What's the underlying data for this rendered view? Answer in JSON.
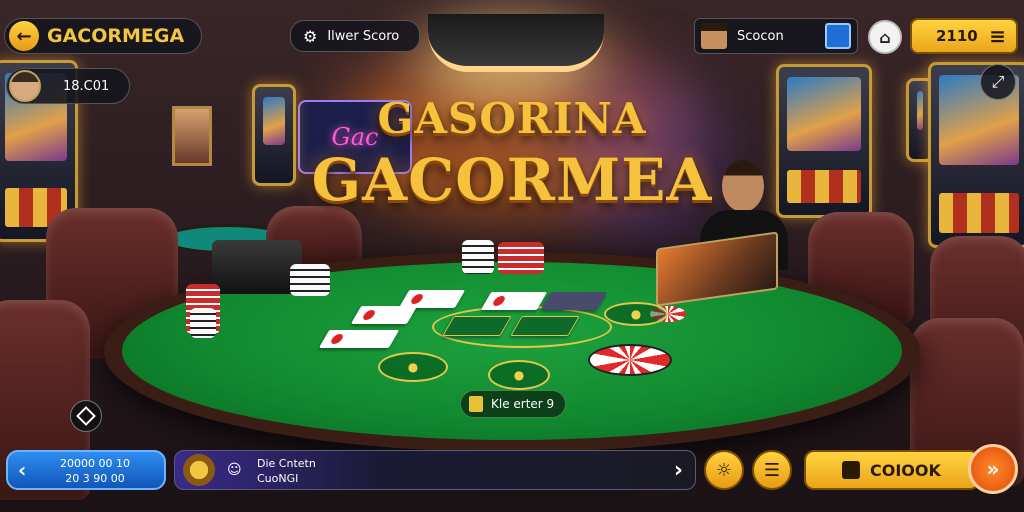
{
  "header": {
    "back_icon": "arrow-left-icon",
    "app_title": "GACORMEGA",
    "settings_icon": "gear-icon",
    "room_label": "Ilwer Scoro",
    "profile_name": "Scocon",
    "profile_badge_icon": "chip-icon",
    "shop_icon": "store-icon",
    "coins_value": "2110",
    "menu_icon": "hamburger-icon",
    "balance_value": "18.C01",
    "fullscreen_icon": "expand-icon"
  },
  "scene": {
    "title_line1": "GASORINA",
    "title_line2": "GACORMEA",
    "neon_sign": "Gac"
  },
  "table": {
    "hint_label": "Kle erter 9"
  },
  "footer": {
    "bet_line1": "20000 00 10",
    "bet_line2": "20 3 90 00",
    "chat_line1": "Die Cntetn",
    "chat_line2": "CuoNGI",
    "check_label": "COIOOK"
  },
  "colors": {
    "accent_gold": "#f6c23c",
    "felt_green": "#118a30",
    "button_blue": "#1f6fd8",
    "button_orange": "#ff6a10"
  }
}
